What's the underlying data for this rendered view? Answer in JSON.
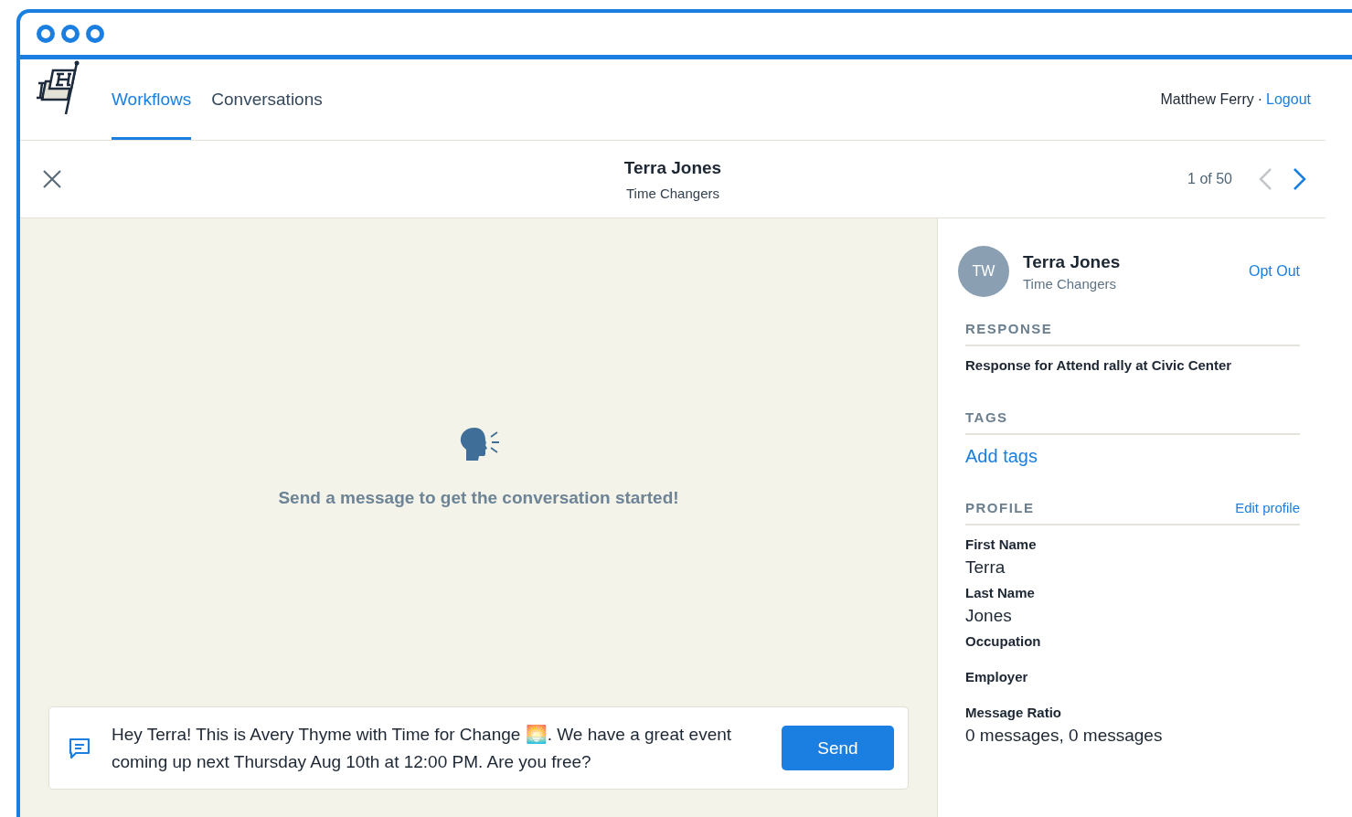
{
  "nav": {
    "tabs": [
      {
        "label": "Workflows",
        "selected": true
      },
      {
        "label": "Conversations",
        "selected": false
      }
    ],
    "user": "Matthew Ferry",
    "separator": "·",
    "logout": "Logout"
  },
  "conversation_header": {
    "name": "Terra Jones",
    "organization": "Time Changers",
    "pager": "1 of 50",
    "prev_disabled": true,
    "next_disabled": false
  },
  "chat": {
    "empty_message": "Send a message to get the conversation started!",
    "composer": {
      "text": "Hey Terra! This is Avery Thyme with Time for Change 🌅. We have a great event coming up next Thursday Aug 10th at 12:00 PM. Are you free?",
      "send": "Send"
    }
  },
  "contact": {
    "initials": "TW",
    "name": "Terra Jones",
    "organization": "Time Changers",
    "opt_out": "Opt Out"
  },
  "sections": [
    {
      "kind": "text",
      "heading": "RESPONSE",
      "text": "Response for Attend rally at Civic Center"
    },
    {
      "kind": "link",
      "heading": "TAGS",
      "link": "Add tags"
    },
    {
      "kind": "fields",
      "heading": "PROFILE",
      "action": "Edit profile",
      "fields": [
        {
          "label": "First Name",
          "value": "Terra"
        },
        {
          "label": "Last Name",
          "value": "Jones"
        },
        {
          "label": "Occupation"
        },
        {
          "label": "Employer"
        },
        {
          "label": "Message Ratio",
          "value": "0 messages, 0 messages"
        }
      ]
    }
  ]
}
